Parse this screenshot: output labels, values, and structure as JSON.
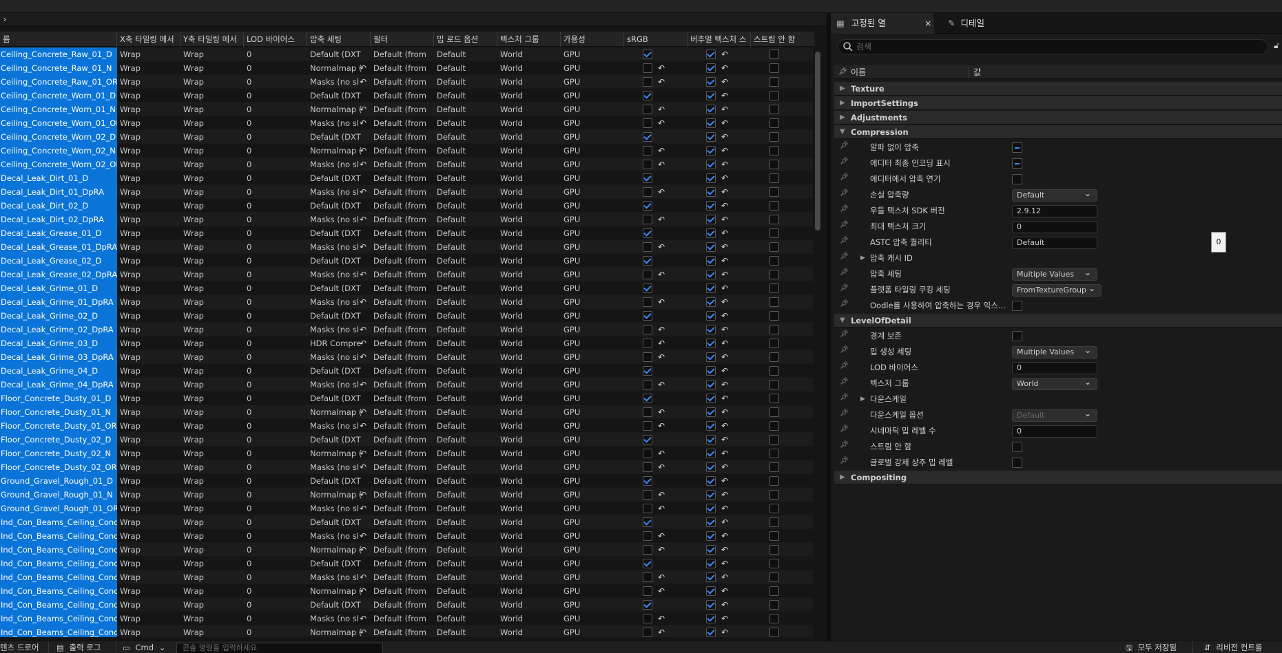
{
  "table": {
    "columns": [
      "름",
      "X축 타일링 메서",
      "Y축 타일링 메서",
      "LOD 바이어스",
      "압축 세팅",
      "필터",
      "밉 로드 옵션",
      "텍스처 그룹",
      "가용성",
      "sRGB",
      "버추얼 텍스처 스",
      "스트림 안 함"
    ],
    "rows": [
      {
        "name": "Ceiling_Concrete_Raw_01_D",
        "x": "Wrap",
        "y": "Wrap",
        "lod": "0",
        "comp": "Default (DXT",
        "filter": "Default (from",
        "mip": "Default",
        "group": "World",
        "avail": "GPU",
        "srgb": true,
        "srgb_rev": false,
        "vt_rev": true
      },
      {
        "name": "Ceiling_Concrete_Raw_01_N",
        "x": "Wrap",
        "y": "Wrap",
        "lod": "0",
        "comp": "Normalmap (",
        "filter": "Default (from",
        "mip": "Default",
        "group": "World",
        "avail": "GPU",
        "srgb": false,
        "srgb_rev": true,
        "vt_rev": true
      },
      {
        "name": "Ceiling_Concrete_Raw_01_ORD",
        "x": "Wrap",
        "y": "Wrap",
        "lod": "0",
        "comp": "Masks (no sl",
        "filter": "Default (from",
        "mip": "Default",
        "group": "World",
        "avail": "GPU",
        "srgb": false,
        "srgb_rev": true,
        "vt_rev": true
      },
      {
        "name": "Ceiling_Concrete_Worn_01_D",
        "x": "Wrap",
        "y": "Wrap",
        "lod": "0",
        "comp": "Default (DXT",
        "filter": "Default (from",
        "mip": "Default",
        "group": "World",
        "avail": "GPU",
        "srgb": true,
        "srgb_rev": false,
        "vt_rev": true
      },
      {
        "name": "Ceiling_Concrete_Worn_01_N",
        "x": "Wrap",
        "y": "Wrap",
        "lod": "0",
        "comp": "Normalmap (",
        "filter": "Default (from",
        "mip": "Default",
        "group": "World",
        "avail": "GPU",
        "srgb": false,
        "srgb_rev": true,
        "vt_rev": true
      },
      {
        "name": "Ceiling_Concrete_Worn_01_ORD",
        "x": "Wrap",
        "y": "Wrap",
        "lod": "0",
        "comp": "Masks (no sl",
        "filter": "Default (from",
        "mip": "Default",
        "group": "World",
        "avail": "GPU",
        "srgb": false,
        "srgb_rev": true,
        "vt_rev": true
      },
      {
        "name": "Ceiling_Concrete_Worn_02_D",
        "x": "Wrap",
        "y": "Wrap",
        "lod": "0",
        "comp": "Default (DXT",
        "filter": "Default (from",
        "mip": "Default",
        "group": "World",
        "avail": "GPU",
        "srgb": true,
        "srgb_rev": false,
        "vt_rev": true
      },
      {
        "name": "Ceiling_Concrete_Worn_02_N",
        "x": "Wrap",
        "y": "Wrap",
        "lod": "0",
        "comp": "Normalmap (",
        "filter": "Default (from",
        "mip": "Default",
        "group": "World",
        "avail": "GPU",
        "srgb": false,
        "srgb_rev": true,
        "vt_rev": true
      },
      {
        "name": "Ceiling_Concrete_Worn_02_ORD",
        "x": "Wrap",
        "y": "Wrap",
        "lod": "0",
        "comp": "Masks (no sl",
        "filter": "Default (from",
        "mip": "Default",
        "group": "World",
        "avail": "GPU",
        "srgb": false,
        "srgb_rev": true,
        "vt_rev": true
      },
      {
        "name": "Decal_Leak_Dirt_01_D",
        "x": "Wrap",
        "y": "Wrap",
        "lod": "0",
        "comp": "Default (DXT",
        "filter": "Default (from",
        "mip": "Default",
        "group": "World",
        "avail": "GPU",
        "srgb": true,
        "srgb_rev": false,
        "vt_rev": true
      },
      {
        "name": "Decal_Leak_Dirt_01_DpRA",
        "x": "Wrap",
        "y": "Wrap",
        "lod": "0",
        "comp": "Masks (no sl",
        "filter": "Default (from",
        "mip": "Default",
        "group": "World",
        "avail": "GPU",
        "srgb": false,
        "srgb_rev": true,
        "vt_rev": true
      },
      {
        "name": "Decal_Leak_Dirt_02_D",
        "x": "Wrap",
        "y": "Wrap",
        "lod": "0",
        "comp": "Default (DXT",
        "filter": "Default (from",
        "mip": "Default",
        "group": "World",
        "avail": "GPU",
        "srgb": true,
        "srgb_rev": false,
        "vt_rev": true
      },
      {
        "name": "Decal_Leak_Dirt_02_DpRA",
        "x": "Wrap",
        "y": "Wrap",
        "lod": "0",
        "comp": "Masks (no sl",
        "filter": "Default (from",
        "mip": "Default",
        "group": "World",
        "avail": "GPU",
        "srgb": false,
        "srgb_rev": true,
        "vt_rev": true
      },
      {
        "name": "Decal_Leak_Grease_01_D",
        "x": "Wrap",
        "y": "Wrap",
        "lod": "0",
        "comp": "Default (DXT",
        "filter": "Default (from",
        "mip": "Default",
        "group": "World",
        "avail": "GPU",
        "srgb": true,
        "srgb_rev": false,
        "vt_rev": true
      },
      {
        "name": "Decal_Leak_Grease_01_DpRA",
        "x": "Wrap",
        "y": "Wrap",
        "lod": "0",
        "comp": "Masks (no sl",
        "filter": "Default (from",
        "mip": "Default",
        "group": "World",
        "avail": "GPU",
        "srgb": false,
        "srgb_rev": true,
        "vt_rev": true
      },
      {
        "name": "Decal_Leak_Grease_02_D",
        "x": "Wrap",
        "y": "Wrap",
        "lod": "0",
        "comp": "Default (DXT",
        "filter": "Default (from",
        "mip": "Default",
        "group": "World",
        "avail": "GPU",
        "srgb": true,
        "srgb_rev": false,
        "vt_rev": true
      },
      {
        "name": "Decal_Leak_Grease_02_DpRA",
        "x": "Wrap",
        "y": "Wrap",
        "lod": "0",
        "comp": "Masks (no sl",
        "filter": "Default (from",
        "mip": "Default",
        "group": "World",
        "avail": "GPU",
        "srgb": false,
        "srgb_rev": true,
        "vt_rev": true
      },
      {
        "name": "Decal_Leak_Grime_01_D",
        "x": "Wrap",
        "y": "Wrap",
        "lod": "0",
        "comp": "Default (DXT",
        "filter": "Default (from",
        "mip": "Default",
        "group": "World",
        "avail": "GPU",
        "srgb": true,
        "srgb_rev": false,
        "vt_rev": true
      },
      {
        "name": "Decal_Leak_Grime_01_DpRA",
        "x": "Wrap",
        "y": "Wrap",
        "lod": "0",
        "comp": "Masks (no sl",
        "filter": "Default (from",
        "mip": "Default",
        "group": "World",
        "avail": "GPU",
        "srgb": false,
        "srgb_rev": true,
        "vt_rev": true
      },
      {
        "name": "Decal_Leak_Grime_02_D",
        "x": "Wrap",
        "y": "Wrap",
        "lod": "0",
        "comp": "Default (DXT",
        "filter": "Default (from",
        "mip": "Default",
        "group": "World",
        "avail": "GPU",
        "srgb": true,
        "srgb_rev": false,
        "vt_rev": true
      },
      {
        "name": "Decal_Leak_Grime_02_DpRA",
        "x": "Wrap",
        "y": "Wrap",
        "lod": "0",
        "comp": "Masks (no sl",
        "filter": "Default (from",
        "mip": "Default",
        "group": "World",
        "avail": "GPU",
        "srgb": false,
        "srgb_rev": true,
        "vt_rev": true
      },
      {
        "name": "Decal_Leak_Grime_03_D",
        "x": "Wrap",
        "y": "Wrap",
        "lod": "0",
        "comp": "HDR Compre",
        "filter": "Default (from",
        "mip": "Default",
        "group": "World",
        "avail": "GPU",
        "srgb": false,
        "srgb_rev": true,
        "vt_rev": true
      },
      {
        "name": "Decal_Leak_Grime_03_DpRA",
        "x": "Wrap",
        "y": "Wrap",
        "lod": "0",
        "comp": "Masks (no sl",
        "filter": "Default (from",
        "mip": "Default",
        "group": "World",
        "avail": "GPU",
        "srgb": false,
        "srgb_rev": true,
        "vt_rev": true
      },
      {
        "name": "Decal_Leak_Grime_04_D",
        "x": "Wrap",
        "y": "Wrap",
        "lod": "0",
        "comp": "Default (DXT",
        "filter": "Default (from",
        "mip": "Default",
        "group": "World",
        "avail": "GPU",
        "srgb": true,
        "srgb_rev": false,
        "vt_rev": true
      },
      {
        "name": "Decal_Leak_Grime_04_DpRA",
        "x": "Wrap",
        "y": "Wrap",
        "lod": "0",
        "comp": "Masks (no sl",
        "filter": "Default (from",
        "mip": "Default",
        "group": "World",
        "avail": "GPU",
        "srgb": false,
        "srgb_rev": true,
        "vt_rev": true
      },
      {
        "name": "Floor_Concrete_Dusty_01_D",
        "x": "Wrap",
        "y": "Wrap",
        "lod": "0",
        "comp": "Default (DXT",
        "filter": "Default (from",
        "mip": "Default",
        "group": "World",
        "avail": "GPU",
        "srgb": true,
        "srgb_rev": false,
        "vt_rev": true
      },
      {
        "name": "Floor_Concrete_Dusty_01_N",
        "x": "Wrap",
        "y": "Wrap",
        "lod": "0",
        "comp": "Normalmap (",
        "filter": "Default (from",
        "mip": "Default",
        "group": "World",
        "avail": "GPU",
        "srgb": false,
        "srgb_rev": true,
        "vt_rev": true
      },
      {
        "name": "Floor_Concrete_Dusty_01_ORD",
        "x": "Wrap",
        "y": "Wrap",
        "lod": "0",
        "comp": "Masks (no sl",
        "filter": "Default (from",
        "mip": "Default",
        "group": "World",
        "avail": "GPU",
        "srgb": false,
        "srgb_rev": true,
        "vt_rev": true
      },
      {
        "name": "Floor_Concrete_Dusty_02_D",
        "x": "Wrap",
        "y": "Wrap",
        "lod": "0",
        "comp": "Default (DXT",
        "filter": "Default (from",
        "mip": "Default",
        "group": "World",
        "avail": "GPU",
        "srgb": true,
        "srgb_rev": false,
        "vt_rev": true
      },
      {
        "name": "Floor_Concrete_Dusty_02_N",
        "x": "Wrap",
        "y": "Wrap",
        "lod": "0",
        "comp": "Normalmap (",
        "filter": "Default (from",
        "mip": "Default",
        "group": "World",
        "avail": "GPU",
        "srgb": false,
        "srgb_rev": true,
        "vt_rev": true
      },
      {
        "name": "Floor_Concrete_Dusty_02_ORD",
        "x": "Wrap",
        "y": "Wrap",
        "lod": "0",
        "comp": "Masks (no sl",
        "filter": "Default (from",
        "mip": "Default",
        "group": "World",
        "avail": "GPU",
        "srgb": false,
        "srgb_rev": true,
        "vt_rev": true
      },
      {
        "name": "Ground_Gravel_Rough_01_D",
        "x": "Wrap",
        "y": "Wrap",
        "lod": "0",
        "comp": "Default (DXT",
        "filter": "Default (from",
        "mip": "Default",
        "group": "World",
        "avail": "GPU",
        "srgb": true,
        "srgb_rev": false,
        "vt_rev": true
      },
      {
        "name": "Ground_Gravel_Rough_01_N",
        "x": "Wrap",
        "y": "Wrap",
        "lod": "0",
        "comp": "Normalmap (",
        "filter": "Default (from",
        "mip": "Default",
        "group": "World",
        "avail": "GPU",
        "srgb": false,
        "srgb_rev": true,
        "vt_rev": true
      },
      {
        "name": "Ground_Gravel_Rough_01_ORD",
        "x": "Wrap",
        "y": "Wrap",
        "lod": "0",
        "comp": "Masks (no sl",
        "filter": "Default (from",
        "mip": "Default",
        "group": "World",
        "avail": "GPU",
        "srgb": false,
        "srgb_rev": true,
        "vt_rev": true
      },
      {
        "name": "Ind_Con_Beams_Ceiling_Concr",
        "x": "Wrap",
        "y": "Wrap",
        "lod": "0",
        "comp": "Default (DXT",
        "filter": "Default (from",
        "mip": "Default",
        "group": "World",
        "avail": "GPU",
        "srgb": true,
        "srgb_rev": false,
        "vt_rev": true
      },
      {
        "name": "Ind_Con_Beams_Ceiling_Concr",
        "x": "Wrap",
        "y": "Wrap",
        "lod": "0",
        "comp": "Masks (no sl",
        "filter": "Default (from",
        "mip": "Default",
        "group": "World",
        "avail": "GPU",
        "srgb": false,
        "srgb_rev": true,
        "vt_rev": true
      },
      {
        "name": "Ind_Con_Beams_Ceiling_Concr",
        "x": "Wrap",
        "y": "Wrap",
        "lod": "0",
        "comp": "Normalmap (",
        "filter": "Default (from",
        "mip": "Default",
        "group": "World",
        "avail": "GPU",
        "srgb": false,
        "srgb_rev": true,
        "vt_rev": true
      },
      {
        "name": "Ind_Con_Beams_Ceiling_Concr",
        "x": "Wrap",
        "y": "Wrap",
        "lod": "0",
        "comp": "Default (DXT",
        "filter": "Default (from",
        "mip": "Default",
        "group": "World",
        "avail": "GPU",
        "srgb": true,
        "srgb_rev": false,
        "vt_rev": true
      },
      {
        "name": "Ind_Con_Beams_Ceiling_Concr",
        "x": "Wrap",
        "y": "Wrap",
        "lod": "0",
        "comp": "Masks (no sl",
        "filter": "Default (from",
        "mip": "Default",
        "group": "World",
        "avail": "GPU",
        "srgb": false,
        "srgb_rev": true,
        "vt_rev": true
      },
      {
        "name": "Ind_Con_Beams_Ceiling_Concr",
        "x": "Wrap",
        "y": "Wrap",
        "lod": "0",
        "comp": "Normalmap (",
        "filter": "Default (from",
        "mip": "Default",
        "group": "World",
        "avail": "GPU",
        "srgb": false,
        "srgb_rev": true,
        "vt_rev": true
      },
      {
        "name": "Ind_Con_Beams_Ceiling_Concr",
        "x": "Wrap",
        "y": "Wrap",
        "lod": "0",
        "comp": "Default (DXT",
        "filter": "Default (from",
        "mip": "Default",
        "group": "World",
        "avail": "GPU",
        "srgb": true,
        "srgb_rev": false,
        "vt_rev": true
      },
      {
        "name": "Ind_Con_Beams_Ceiling_Concr",
        "x": "Wrap",
        "y": "Wrap",
        "lod": "0",
        "comp": "Masks (no sl",
        "filter": "Default (from",
        "mip": "Default",
        "group": "World",
        "avail": "GPU",
        "srgb": false,
        "srgb_rev": true,
        "vt_rev": true
      },
      {
        "name": "Ind_Con_Beams_Ceiling_Concr",
        "x": "Wrap",
        "y": "Wrap",
        "lod": "0",
        "comp": "Normalmap (",
        "filter": "Default (from",
        "mip": "Default",
        "group": "World",
        "avail": "GPU",
        "srgb": false,
        "srgb_rev": true,
        "vt_rev": true
      }
    ]
  },
  "panel": {
    "tab_pinned": "고정된 열",
    "tab_details": "디테일",
    "search_placeholder": "검색",
    "col_name": "이름",
    "col_value": "값",
    "sections": {
      "texture": "Texture",
      "import": "ImportSettings",
      "adjustments": "Adjustments",
      "compression": "Compression",
      "lod": "LevelOfDetail",
      "compositing": "Compositing"
    },
    "compression_props": [
      {
        "label": "알파 없이 압축",
        "kind": "check-ind"
      },
      {
        "label": "에디터 최종 인코딩 표시",
        "kind": "check-ind"
      },
      {
        "label": "에디터에서 압축 연기",
        "kind": "check"
      },
      {
        "label": "손실 압축량",
        "kind": "dropdown",
        "value": "Default"
      },
      {
        "label": "우들 텍스처 SDK 버전",
        "kind": "text",
        "value": "2.9.12"
      },
      {
        "label": "최대 텍스처 크기",
        "kind": "text",
        "value": "0"
      },
      {
        "label": "ASTC 압축 퀄리티",
        "kind": "text",
        "value": "Default"
      },
      {
        "label": "압축 캐시 ID",
        "kind": "expand"
      },
      {
        "label": "압축 세팅",
        "kind": "dropdown",
        "value": "Multiple Values"
      },
      {
        "label": "플랫폼 타일링 쿠킹 세팅",
        "kind": "dropdown",
        "value": "FromTextureGroup"
      },
      {
        "label": "Oodle를 사용하여 압축하는 경우 익스...",
        "kind": "check"
      }
    ],
    "lod_props": [
      {
        "label": "경계 보존",
        "kind": "check"
      },
      {
        "label": "밉 생성 세팅",
        "kind": "dropdown",
        "value": "Multiple Values"
      },
      {
        "label": "LOD 바이어스",
        "kind": "text",
        "value": "0"
      },
      {
        "label": "텍스처 그룹",
        "kind": "dropdown",
        "value": "World"
      },
      {
        "label": "다운스케일",
        "kind": "expand"
      },
      {
        "label": "다운스케일 옵션",
        "kind": "dropdown-dis",
        "value": "Default"
      },
      {
        "label": "시네마틱 밉 레벨 수",
        "kind": "text",
        "value": "0"
      },
      {
        "label": "스트림 안 함",
        "kind": "check"
      },
      {
        "label": "글로벌 강제 상주 밉 레벨",
        "kind": "check"
      }
    ],
    "tooltip_value": "0"
  },
  "bottom": {
    "content_drawer": "텐츠 드로어",
    "output_log": "출력 로그",
    "cmd": "Cmd",
    "cmd_placeholder": "콘솔 명령을 입력하세요",
    "save_all": "모두 저장됨",
    "revision": "리비전 컨트롤"
  }
}
